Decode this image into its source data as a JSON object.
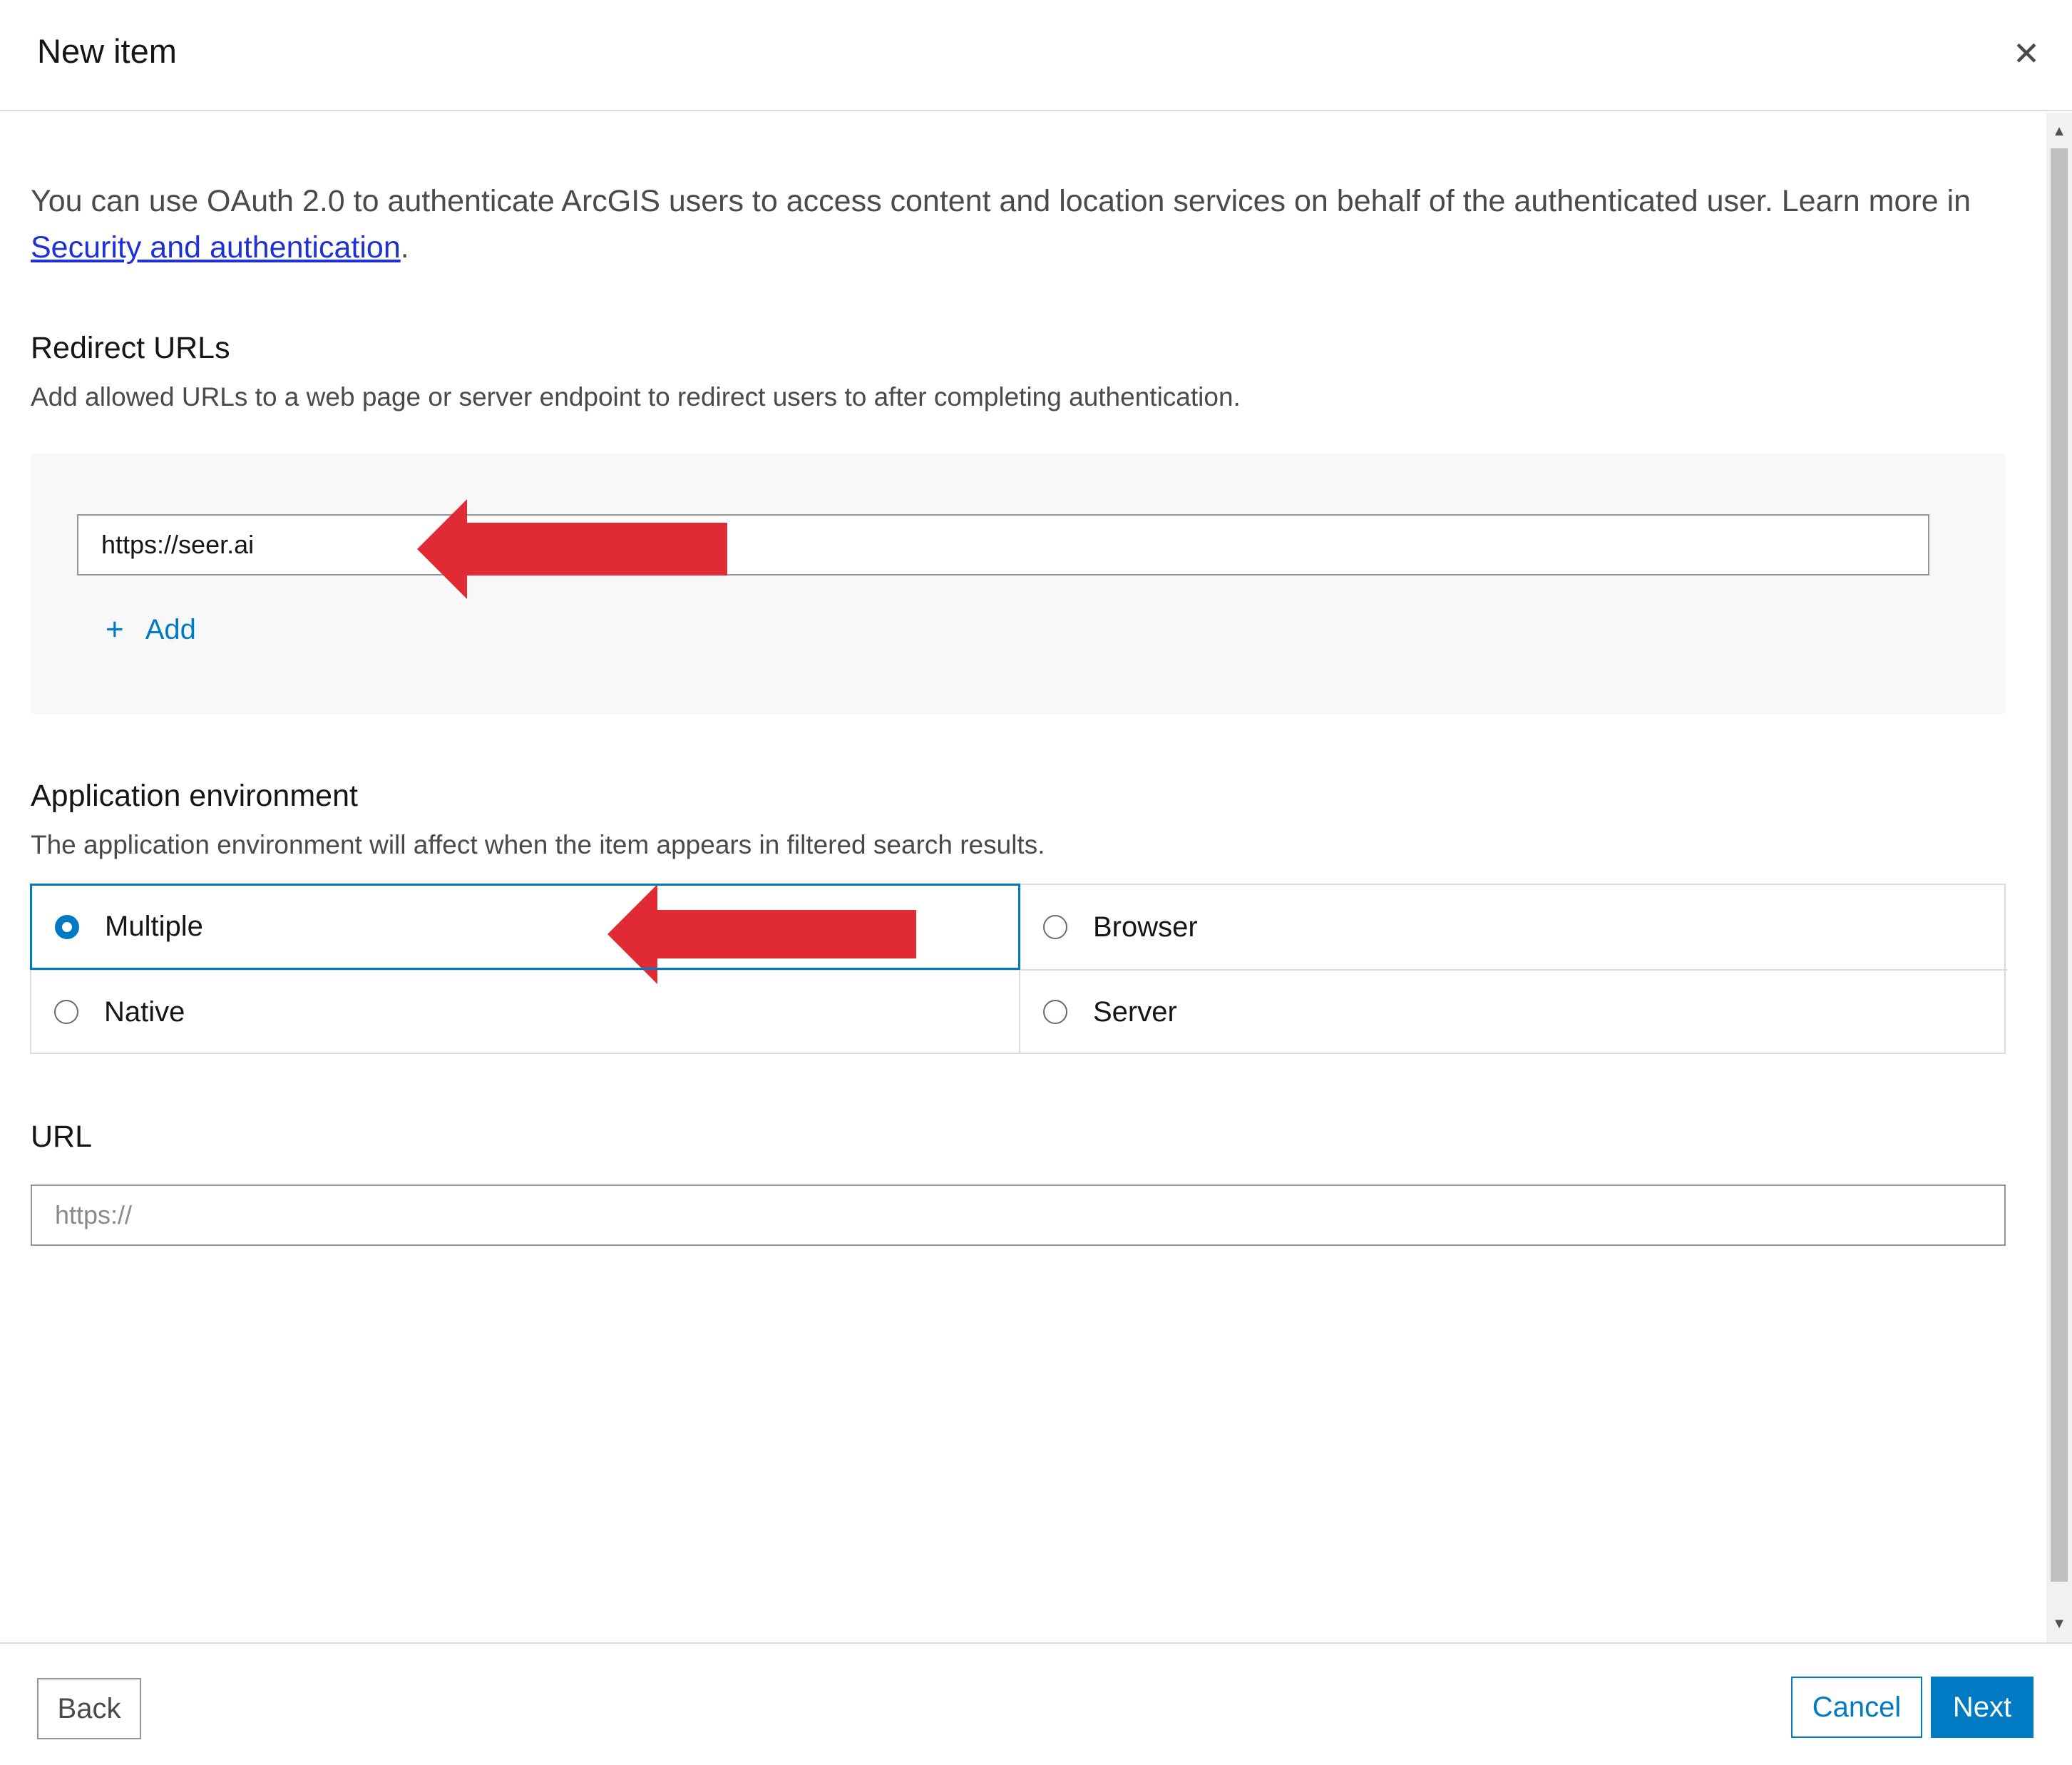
{
  "dialog": {
    "title": "New item",
    "close_icon": "close-icon"
  },
  "intro": {
    "text_before_link": "You can use OAuth 2.0 to authenticate ArcGIS users to access content and location services on behalf of the authenticated user. Learn more in ",
    "link_text": "Security and authentication",
    "text_after_link": "."
  },
  "redirect_urls": {
    "title": "Redirect URLs",
    "description": "Add allowed URLs to a web page or server endpoint to redirect users to after completing authentication.",
    "url_value": "https://seer.ai",
    "add_label": "Add"
  },
  "application_environment": {
    "title": "Application environment",
    "description": "The application environment will affect when the item appears in filtered search results.",
    "options": [
      {
        "label": "Multiple",
        "selected": true
      },
      {
        "label": "Browser",
        "selected": false
      },
      {
        "label": "Native",
        "selected": false
      },
      {
        "label": "Server",
        "selected": false
      }
    ]
  },
  "url": {
    "title": "URL",
    "placeholder": "https://"
  },
  "footer": {
    "back_label": "Back",
    "cancel_label": "Cancel",
    "next_label": "Next"
  },
  "colors": {
    "accent": "#007ac2",
    "annotation_arrow": "#e02b35"
  }
}
